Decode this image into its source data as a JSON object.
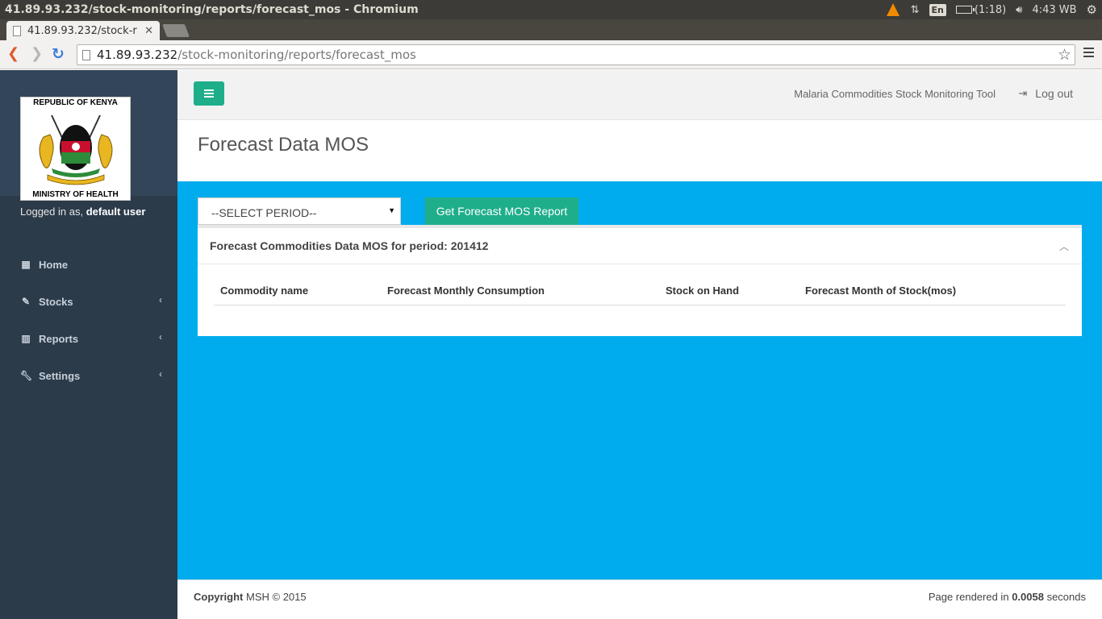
{
  "os": {
    "window_title": "41.89.93.232/stock-monitoring/reports/forecast_mos - Chromium",
    "battery": "(1:18)",
    "clock": "4:43 WB",
    "lang": "En"
  },
  "browser": {
    "tab_title": "41.89.93.232/stock-r",
    "url_host": "41.89.93.232",
    "url_path": "/stock-monitoring/reports/forecast_mos"
  },
  "sidebar": {
    "logo_top": "REPUBLIC OF KENYA",
    "logo_bottom": "MINISTRY OF HEALTH",
    "logged_in_prefix": "Logged in as,",
    "user": "default user",
    "items": [
      {
        "label": "Home",
        "icon": "th-large-icon"
      },
      {
        "label": "Stocks",
        "icon": "edit-icon"
      },
      {
        "label": "Reports",
        "icon": "bar-chart-icon"
      },
      {
        "label": "Settings",
        "icon": "wrench-icon"
      }
    ]
  },
  "header": {
    "tool_name": "Malaria Commodities Stock Monitoring Tool",
    "logout": "Log out"
  },
  "page": {
    "title": "Forecast Data MOS",
    "select_value": "--SELECT PERIOD--",
    "button_label": "Get Forecast MOS Report",
    "panel_title": "Forecast Commodities Data MOS for period: 201412",
    "columns": [
      "Commodity name",
      "Forecast Monthly Consumption",
      "Stock on Hand",
      "Forecast Month of Stock(mos)"
    ]
  },
  "footer": {
    "copyright_label": "Copyright",
    "copyright_rest": "MSH © 2015",
    "render_prefix": "Page rendered in",
    "render_time": "0.0058",
    "render_suffix": "seconds"
  },
  "colors": {
    "sidebar_bg": "#2c3b4a",
    "content_bg": "#00aced",
    "accent_green": "#1fae8a"
  }
}
